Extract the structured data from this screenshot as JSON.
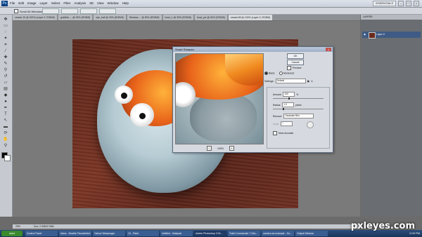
{
  "menubar": {
    "items": [
      "File",
      "Edit",
      "Image",
      "Layer",
      "Select",
      "Filter",
      "Analysis",
      "3D",
      "View",
      "Window",
      "Help"
    ],
    "workspace": "ESSENTIALS"
  },
  "options": {
    "scroll_all_windows": "Scroll All Windows"
  },
  "tabs": [
    "vessel-10 @ 100% (Layer 0, RGB/8)",
    "goldfish-... @ 25% (RGB/8)",
    "eye_ball @ 33% (RGB/8)",
    "Window-... @ 50% (RGB/8)",
    "bowl_1 @ 33% (RGB/8)",
    "bowl_pic @ 50% (RGB/8)",
    "vessel-fill @ 100% (Layer 0, RGB/8)"
  ],
  "status": {
    "zoom": "25%",
    "doc": "Doc: 2.99M/2.99M"
  },
  "dialog": {
    "title": "Smart Sharpen",
    "ok": "OK",
    "cancel": "Cancel",
    "preview": "Preview",
    "basic": "Basic",
    "advanced": "Advanced",
    "settings_label": "Settings:",
    "settings_value": "Default",
    "amount_label": "Amount:",
    "amount_value": "100",
    "amount_unit": "%",
    "radius_label": "Radius:",
    "radius_value": "1.0",
    "radius_unit": "pixels",
    "remove_label": "Remove:",
    "remove_value": "Gaussian Blur",
    "angle_label": "Angle:",
    "angle_value": "0",
    "more_accurate": "More Accurate",
    "preview_zoom": "100%"
  },
  "layers": {
    "tab": "LAYERS",
    "layer_name": "Layer 0"
  },
  "taskbar": {
    "start": "start",
    "tasks": [
      "Control Panel",
      "Inbox - Mozilla Thunderbird",
      "Yahoo! Messenger",
      "10 - Paint",
      "Untitled - Notepad",
      "Adobe Photoshop CS4...",
      "Total Commander 7.04a...",
      "camera as example - Go...",
      "Output Window"
    ],
    "clock": "2:09 PM"
  },
  "watermark": "pxleyes.com"
}
